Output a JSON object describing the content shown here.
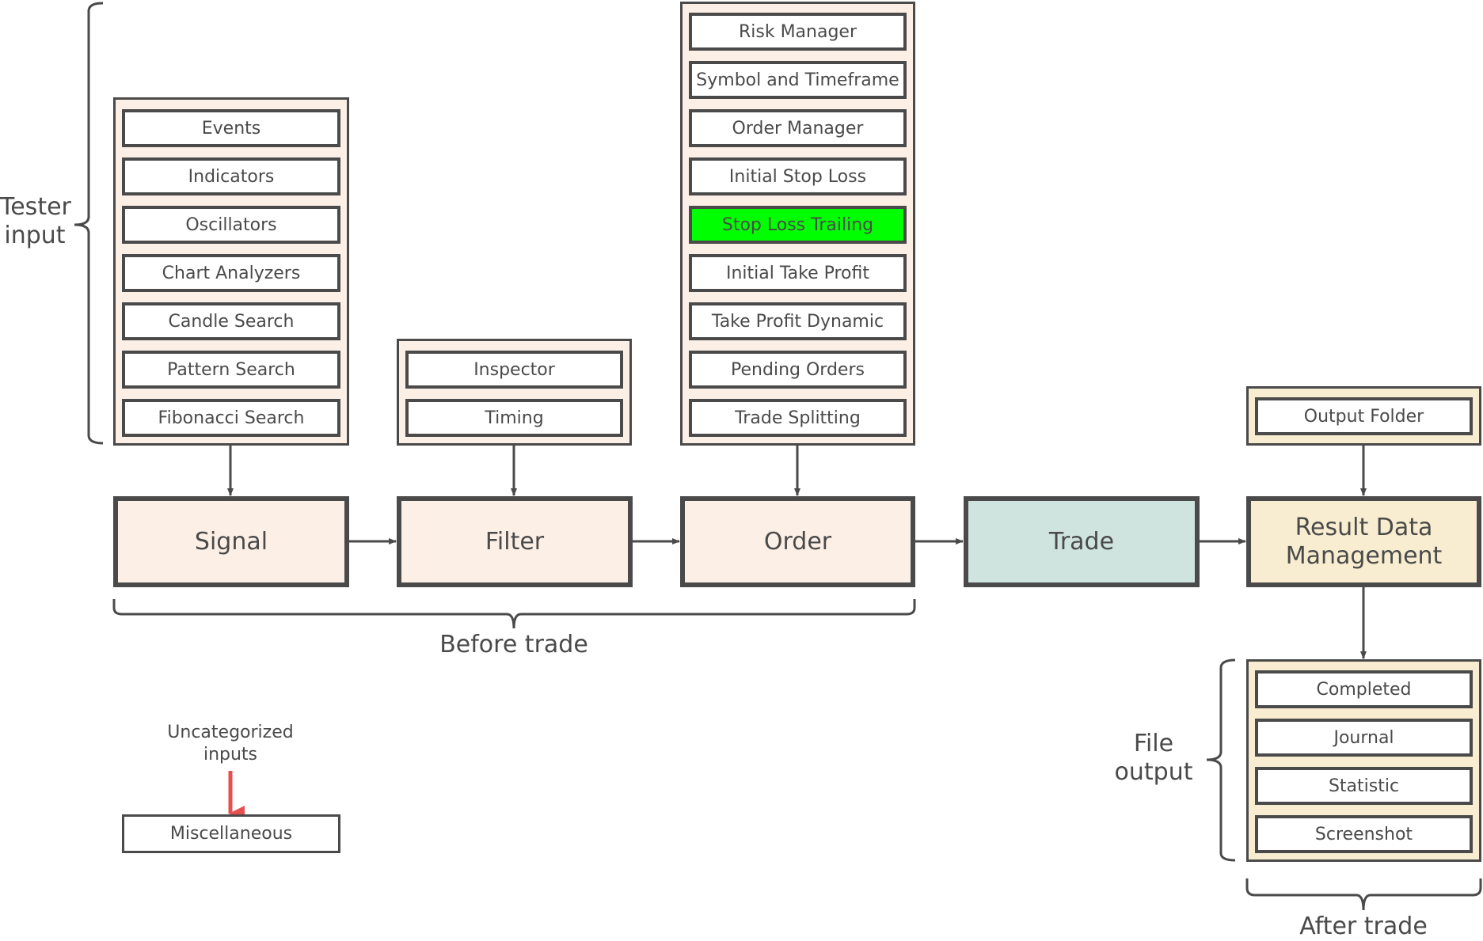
{
  "diagram": {
    "stages": [
      {
        "id": "signal",
        "label": "Signal",
        "color": "#fcefe6"
      },
      {
        "id": "filter",
        "label": "Filter",
        "color": "#fcefe6"
      },
      {
        "id": "order",
        "label": "Order",
        "color": "#fcefe6"
      },
      {
        "id": "trade",
        "label": "Trade",
        "color": "#cfe4df"
      },
      {
        "id": "result",
        "label": "Result Data Management",
        "color": "#f8edd0"
      }
    ],
    "input_groups": {
      "signal": [
        "Events",
        "Indicators",
        "Oscillators",
        "Chart Analyzers",
        "Candle Search",
        "Pattern Search",
        "Fibonacci Search"
      ],
      "filter": [
        "Inspector",
        "Timing"
      ],
      "order": [
        "Risk Manager",
        "Symbol and Timeframe",
        "Order Manager",
        "Initial Stop Loss",
        "Stop Loss Trailing",
        "Initial Take Profit",
        "Take Profit Dynamic",
        "Pending Orders",
        "Trade Splitting"
      ],
      "result": [
        "Output Folder"
      ]
    },
    "highlighted_item": {
      "label": "Stop Loss Trailing",
      "color": "#00ff00"
    },
    "file_output": [
      "Completed",
      "Journal",
      "Statistic",
      "Screenshot"
    ],
    "misc": {
      "note": "Uncategorized inputs",
      "box": "Miscellaneous",
      "arrow_color": "#e85050"
    },
    "annotations": {
      "tester_input": "Tester input",
      "before_trade": "Before trade",
      "after_trade": "After trade",
      "file_output": "File output"
    },
    "colors": {
      "stroke": "#4a4a4a",
      "peach": "#fcefe6",
      "teal": "#cfe4df",
      "cream": "#f8edd0",
      "highlight": "#00ff00"
    }
  }
}
